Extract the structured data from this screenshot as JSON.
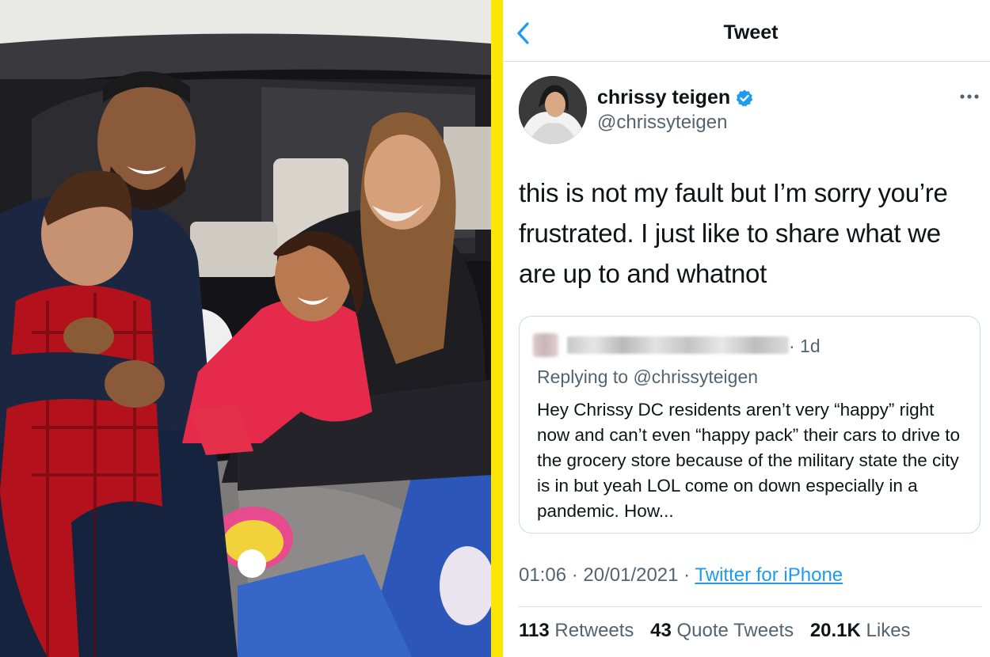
{
  "header": {
    "title": "Tweet",
    "back_icon": "chevron-left-icon"
  },
  "author": {
    "name": "chrissy teigen",
    "handle": "@chrissyteigen",
    "verified_icon": "verified-badge-icon",
    "more_icon": "more-horizontal-icon"
  },
  "tweet": {
    "text": "this is not my fault but I’m sorry you’re frustrated. I just like to share what we are up to and whatnot"
  },
  "quoted": {
    "time": "· 1d",
    "replying_to": "Replying to @chrissyteigen",
    "text": "Hey Chrissy DC residents aren’t very “happy” right now and can’t even “happy pack” their cars to drive to the grocery store because of the military state the city is in but yeah LOL come on down especially in a pandemic. How..."
  },
  "meta": {
    "timestamp": "01:06 · 20/01/2021 · ",
    "source": "Twitter for iPhone"
  },
  "stats": {
    "retweets_count": "113",
    "retweets_label": "Retweets",
    "quotes_count": "43",
    "quotes_label": "Quote Tweets",
    "likes_count": "20.1K",
    "likes_label": "Likes"
  },
  "colors": {
    "accent": "#1d9bf0",
    "divider": "#ffe600",
    "muted": "#536471"
  }
}
